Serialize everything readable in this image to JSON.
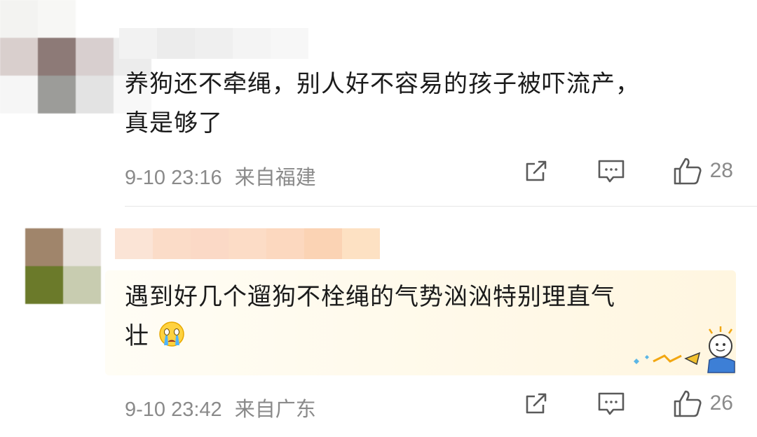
{
  "comments": [
    {
      "text_line1": "养狗还不牵绳，别人好不容易的孩子被吓流产，",
      "text_line2": "真是够了",
      "time": "9-10 23:16",
      "location": "来自福建",
      "likes": "28"
    },
    {
      "text_line1": "遇到好几个遛狗不栓绳的气势汹汹特别理直气",
      "text_line2": "壮",
      "time": "9-10 23:42",
      "location": "来自广东",
      "likes": "26"
    }
  ],
  "icons": {
    "share": "share-icon",
    "reply": "comment-icon",
    "like": "thumbs-up-icon",
    "emoji": "crying-face-emoji"
  },
  "colors": {
    "text": "#1b1b1b",
    "meta": "#8a8a8a",
    "icon": "#555555"
  }
}
